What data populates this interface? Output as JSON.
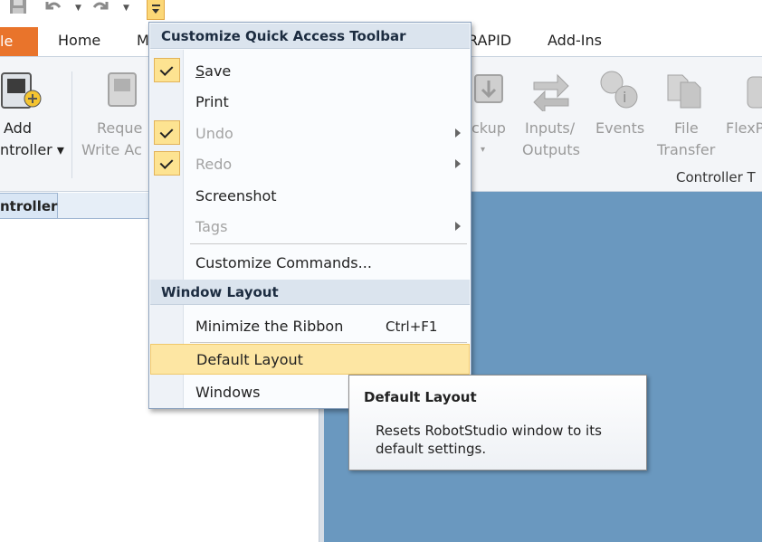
{
  "quick_access": {
    "icons": [
      "save-icon",
      "undo-icon",
      "redo-icon"
    ],
    "customize_button": "customize-quick-access-dropdown"
  },
  "tabs": [
    {
      "label": "le"
    },
    {
      "label": "Home"
    },
    {
      "label": "M"
    },
    {
      "label": "RAPID"
    },
    {
      "label": "Add-Ins"
    }
  ],
  "ribbon": {
    "add_controller": {
      "line1": "Add",
      "line2": "ntroller ▾"
    },
    "request": {
      "line1": "Reque",
      "line2": "Write Ac"
    },
    "backup": {
      "line1": "ckup",
      "line2": "▾"
    },
    "inputs_outputs": {
      "line1": "Inputs/",
      "line2": "Outputs"
    },
    "events": {
      "line1": "Events"
    },
    "file_transfer": {
      "line1": "File",
      "line2": "Transfer"
    },
    "flexpendant": {
      "line1": "FlexP"
    },
    "group_title": "Controller T"
  },
  "panel": {
    "tab_label": "ntroller"
  },
  "menu": {
    "header1": "Customize Quick Access Toolbar",
    "items": [
      {
        "label_u": "S",
        "label_rest": "ave",
        "checked": true
      },
      {
        "label": "Print"
      },
      {
        "label": "Undo",
        "checked": true,
        "disabled": true
      },
      {
        "label": "Redo",
        "checked": true,
        "disabled": true
      },
      {
        "label": "Screenshot"
      },
      {
        "label": "Tags",
        "disabled": true
      },
      {
        "label": "Customize Commands..."
      }
    ],
    "header2": "Window Layout",
    "layout_items": [
      {
        "label": "Minimize the Ribbon",
        "shortcut": "Ctrl+F1"
      },
      {
        "label": "Default Layout",
        "highlighted": true
      },
      {
        "label": "Windows"
      }
    ]
  },
  "tooltip": {
    "title": "Default Layout",
    "body": "Resets RobotStudio window to its default settings."
  },
  "colors": {
    "file_tab": "#e9742b",
    "workspace": "#6a98bf",
    "highlight": "#fde6a3",
    "check_bg": "#fde391"
  }
}
